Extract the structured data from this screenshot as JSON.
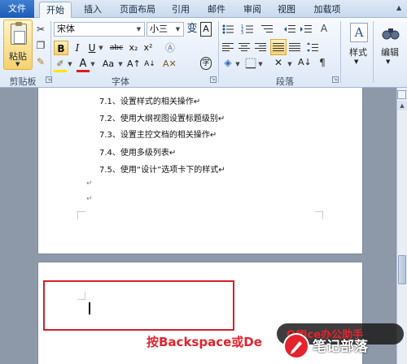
{
  "tabs": [
    {
      "label": "文件"
    },
    {
      "label": "开始"
    },
    {
      "label": "插入"
    },
    {
      "label": "页面布局"
    },
    {
      "label": "引用"
    },
    {
      "label": "邮件"
    },
    {
      "label": "审阅"
    },
    {
      "label": "视图"
    },
    {
      "label": "加载项"
    }
  ],
  "active_tab": "开始",
  "clipboard": {
    "paste_label": "粘贴",
    "group_label": "剪贴板"
  },
  "font": {
    "name": "宋体",
    "size": "小三",
    "group_label": "字体",
    "bold_label": "B",
    "italic_label": "I",
    "underline_label": "U",
    "abc_label": "abc",
    "sub_label": "x₂",
    "sup_label": "x²",
    "aa_label": "Aa",
    "a_label": "A",
    "char_label": "变",
    "border_a_label": "A"
  },
  "paragraph": {
    "group_label": "段落"
  },
  "styles": {
    "label": "样式"
  },
  "editing": {
    "label": "编辑"
  },
  "document": {
    "lines": [
      {
        "text": "7.1、设置样式的相关操作↵"
      },
      {
        "text": "7.2、使用大纲视图设置标题级别↵"
      },
      {
        "text": "7.3、设置主控文档的相关操作↵"
      },
      {
        "text": "7.4、使用多级列表↵"
      },
      {
        "text": "7.5、使用“设计”选项卡下的样式↵"
      }
    ],
    "empty_marks": [
      "↵",
      "↵"
    ]
  },
  "annotation": {
    "text": "按Backspace或De"
  },
  "watermark": {
    "badge_text": "Office办公助手",
    "brand": "笔记部落",
    "url": "www.notetribe.com"
  },
  "colors": {
    "accent_file_tab": "#2a6ac2",
    "annotation_red": "#e3232d",
    "ribbon_bg": "#e4edf8",
    "doc_bg": "#8d98a9"
  }
}
